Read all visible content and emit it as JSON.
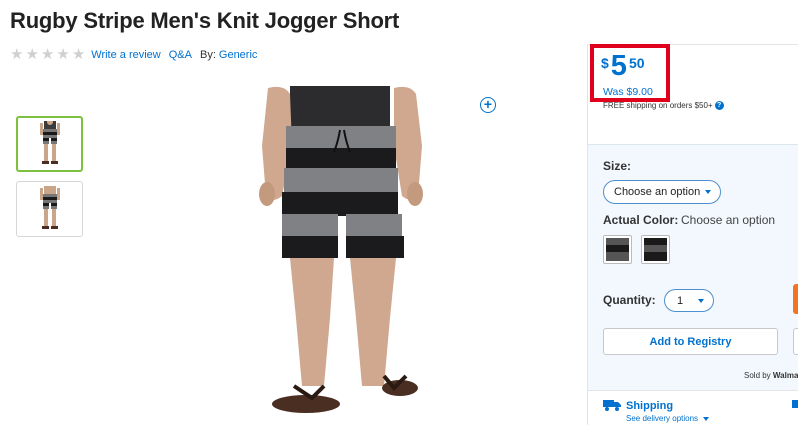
{
  "product": {
    "title": "Rugby Stripe Men's Knit Jogger Short"
  },
  "rating": {
    "stars_filled": 0,
    "stars_total": 5,
    "write_review": "Write a review",
    "qa": "Q&A",
    "by_label": "By:",
    "brand": "Generic"
  },
  "gallery": {
    "thumbnails": [
      "front-view",
      "back-view"
    ],
    "active_index": 0,
    "zoom_icon": "plus-circle-icon"
  },
  "pricing": {
    "currency": "$",
    "dollars": "5",
    "cents": "50",
    "was": "Was $9.00",
    "shipping_note": "FREE shipping on orders $50+",
    "highlight_color": "#e0001b",
    "accent": "#0071ce"
  },
  "options": {
    "size_label": "Size:",
    "size_placeholder": "Choose an option",
    "color_label": "Actual Color:",
    "color_hint": "Choose an option",
    "swatches": [
      {
        "name": "gray-black-stripe",
        "color": "#2f3033"
      },
      {
        "name": "black-gray-stripe",
        "color": "#3a3b3e"
      }
    ],
    "quantity_label": "Quantity:",
    "quantity_value": "1"
  },
  "actions": {
    "registry": "Add to Registry",
    "sold_by_label": "Sold by",
    "sold_by_value": "Walmart"
  },
  "shipping": {
    "title": "Shipping",
    "subtitle": "See delivery options"
  }
}
